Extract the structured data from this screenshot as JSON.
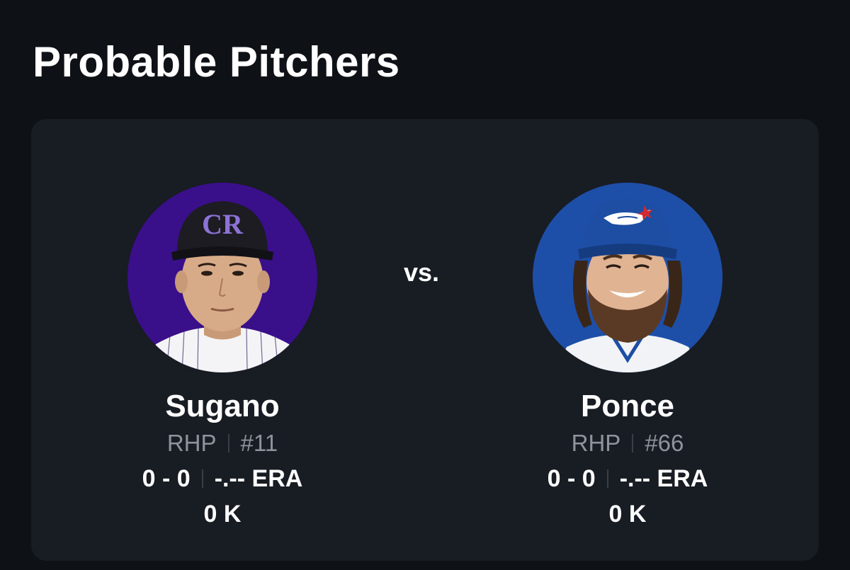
{
  "section_title": "Probable Pitchers",
  "vs_label": "vs.",
  "pitchers": [
    {
      "name": "Sugano",
      "position": "RHP",
      "number": "#11",
      "record": "0 - 0",
      "era": "-.-- ERA",
      "strikeouts": "0 K",
      "photo_bg": "#3a0f8a",
      "cap_color": "#1c1c22",
      "cap_logo": "CR",
      "cap_logo_color": "#7b5fc7"
    },
    {
      "name": "Ponce",
      "position": "RHP",
      "number": "#66",
      "record": "0 - 0",
      "era": "-.-- ERA",
      "strikeouts": "0 K",
      "photo_bg": "#1e4fa8",
      "cap_color": "#1d4ea3",
      "cap_logo": "bird-logo",
      "cap_logo_color": "#ffffff"
    }
  ]
}
